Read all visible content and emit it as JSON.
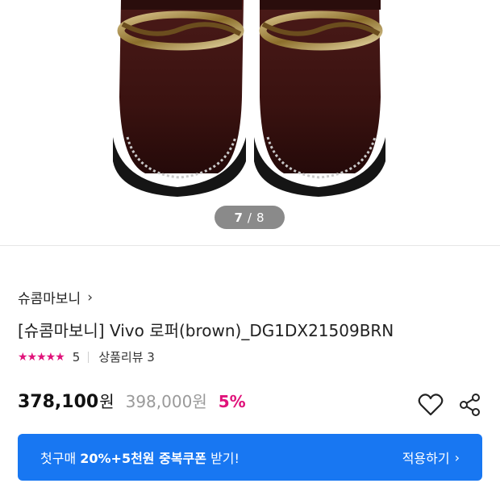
{
  "gallery": {
    "current": "7",
    "separator": "/",
    "total": "8",
    "image_subject": "brown loafers with gold chain"
  },
  "brand": {
    "name": "슈콤마보니",
    "chevron": "›"
  },
  "product": {
    "title": "[슈콤마보니] Vivo 로퍼(brown)_DG1DX21509BRN",
    "stars": "★★★★★",
    "rating": "5",
    "review_label": "상품리뷰 3"
  },
  "price": {
    "sale": "378,100",
    "unit": "원",
    "original": "398,000원",
    "discount": "5%"
  },
  "coupon": {
    "text_prefix": "첫구매 ",
    "text_bold": "20%+5천원 중복쿠폰",
    "text_suffix": " 받기!",
    "action": "적용하기",
    "action_chevron": "›"
  },
  "colors": {
    "accent_pink": "#e0127a",
    "coupon_blue": "#1877f2"
  },
  "icons": [
    "heart-icon",
    "share-icon",
    "chevron-right-icon"
  ]
}
